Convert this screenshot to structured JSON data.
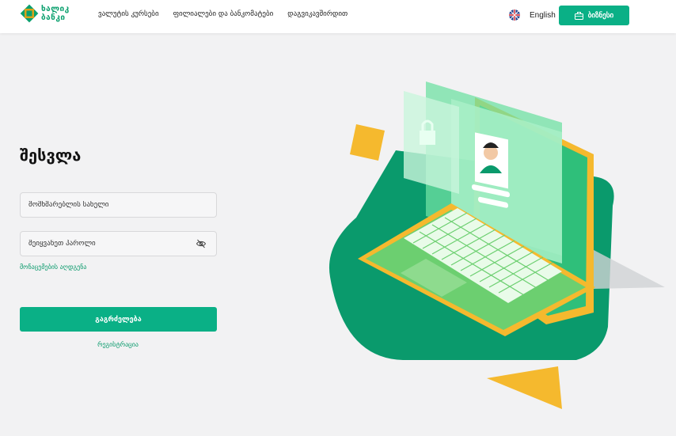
{
  "brand": {
    "name_line1": "ხალიკ",
    "name_line2": "ბანკი",
    "color": "#0aa06e"
  },
  "nav": {
    "items": [
      {
        "label": "ვალუტის კურსები"
      },
      {
        "label": "ფილიალები და ბანკომატები"
      },
      {
        "label": "დაგვიკავშირდით"
      }
    ]
  },
  "language": {
    "label": "English",
    "flag": "uk-flag-icon"
  },
  "business_button": {
    "label": "ბიზნესი",
    "icon": "briefcase-icon"
  },
  "login": {
    "title": "შესვლა",
    "username_placeholder": "მომხმარებლის სახელი",
    "password_placeholder": "შეიყვანეთ პაროლი",
    "password_toggle_icon": "eye-off-icon",
    "forgot_link": "მონაცემების აღდგენა",
    "continue_button": "გაგრძელება",
    "register_link": "რეგისტრაცია"
  },
  "colors": {
    "accent": "#0ab086",
    "background": "#f2f2f3",
    "illustration_green": "#0a9a6c",
    "illustration_yellow": "#f5b92e"
  }
}
